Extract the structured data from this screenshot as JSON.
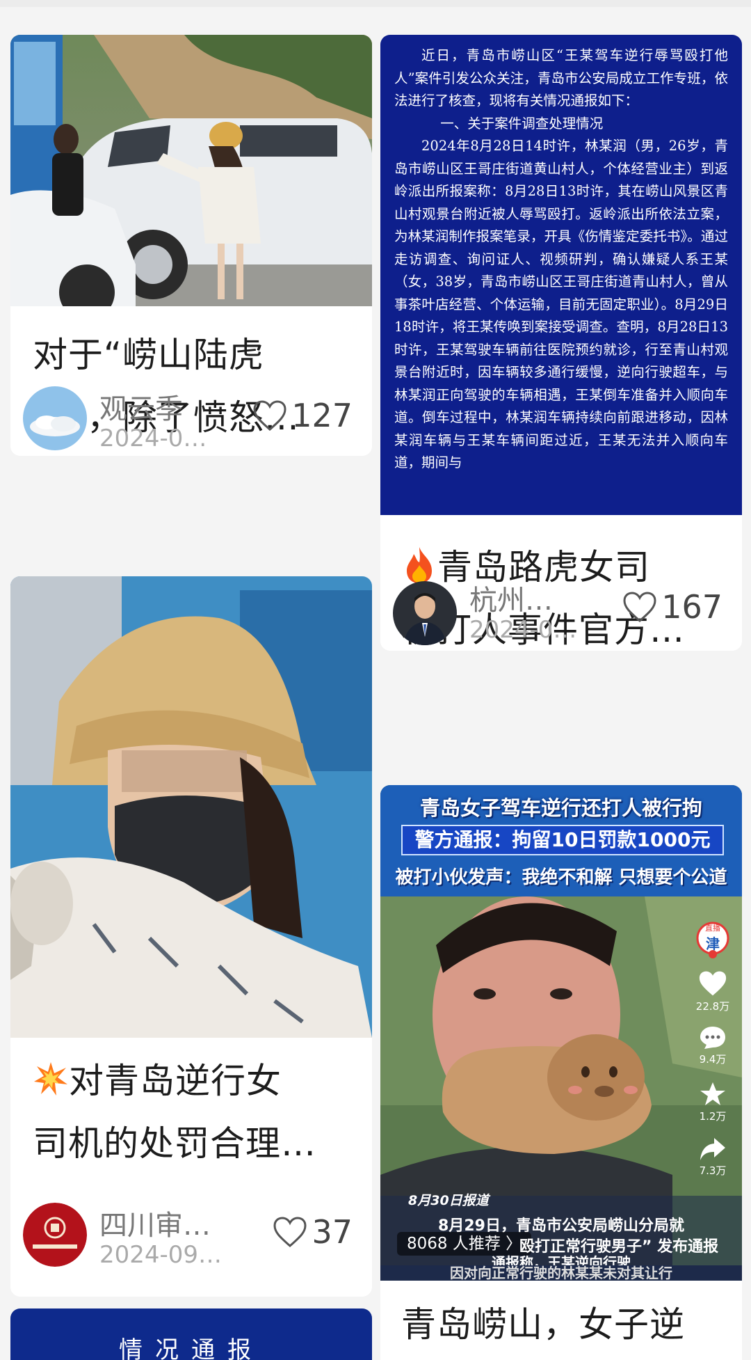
{
  "cards": [
    {
      "title_lines": [
        "对于“崂山陆虎",
        "女”，除了愤怒…"
      ],
      "author": "观云季",
      "date": "2024-0…",
      "likes": "127"
    },
    {
      "title_lines": [
        "青岛路虎女司",
        "机打人事件官方…"
      ],
      "title_icon": "fire-emoji",
      "author": "杭州…",
      "date": "2024-0…",
      "likes": "167"
    },
    {
      "title_lines": [
        "对青岛逆行女",
        "司机的处罚合理…"
      ],
      "title_icon": "collision-emoji",
      "author": "四川审…",
      "date": "2024-09…",
      "likes": "37"
    },
    {
      "title_lines": [
        "青岛崂山，女子逆"
      ]
    }
  ],
  "notice": {
    "intro": "近日，青岛市崂山区“王某驾车逆行辱骂殴打他人”案件引发公众关注，青岛市公安局成立工作专班，依法进行了核查，现将有关情况通报如下：",
    "section": "一、关于案件调查处理情况",
    "body": "2024年8月28日14时许，林某润（男，26岁，青岛市崂山区王哥庄街道黄山村人，个体经营业主）到返岭派出所报案称：8月28日13时许，其在崂山风景区青山村观景台附近被人辱骂殴打。返岭派出所依法立案，为林某润制作报案笔录，开具《伤情鉴定委托书》。通过走访调查、询问证人、视频研判，确认嫌疑人系王某（女，38岁，青岛市崂山区王哥庄街道青山村人，曾从事茶叶店经营、个体运输，目前无固定职业）。8月29日18时许，将王某传唤到案接受调查。查明，8月28日13时许，王某驾驶车辆前往医院预约就诊，行至青山村观景台附近时，因车辆较多通行缓慢，逆向行驶超车，与林某润正向驾驶的车辆相遇，王某倒车准备并入顺向车道。倒车过程中，林某润车辆持续向前跟进移动，因林某润车辆与王某车辆间距过近，王某无法并入顺向车道，期间与"
  },
  "video": {
    "headline": "青岛女子驾车逆行还打人被行拘",
    "police_notice": "警方通报：拘留10日罚款1000元",
    "victim_voice": "被打小伙发声：我绝不和解 只想要个公道",
    "live_badge": "直播",
    "live_char": "津",
    "like_count": "22.8万",
    "comment_count": "9.4万",
    "fav_count": "1.2万",
    "share_count": "7.3万",
    "date_tag": "8月30日报道",
    "subtitle1": "8月29日，青岛市公安局崂山分局就",
    "recommend": "8068 人推荐 〉",
    "subtitle2": "殴打正常行驶男子” 发布通报",
    "subtitle3": "通报称，王某逆向行驶",
    "subtitle4": "因对向正常行驶的林某某未对其让行"
  },
  "bottom_notice": "情况通报",
  "colors": {
    "notice_bg": "#0e1f8c",
    "text_primary": "#1c1c1c",
    "text_secondary": "#777777",
    "text_tertiary": "#aaaaaa",
    "page_bg": "#f4f4f4"
  }
}
